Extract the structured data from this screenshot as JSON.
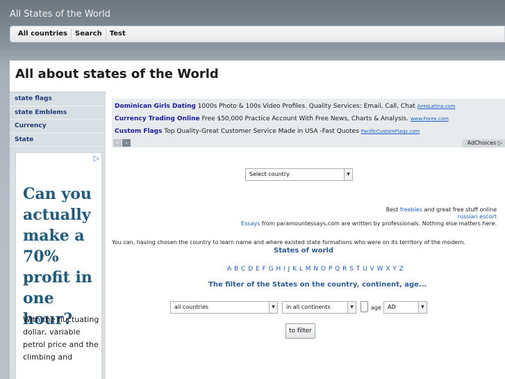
{
  "site": {
    "title": "All States of the World"
  },
  "topnav": {
    "items": [
      "All countries",
      "Search",
      "Test"
    ]
  },
  "page": {
    "title": "All about states of the World"
  },
  "sidebar": {
    "items": [
      "state flags",
      "state Emblems",
      "Currency",
      "State"
    ],
    "ad": {
      "adchoices_icon": "adchoices-triangle",
      "headline": "Can you actually make a 70% profit in one hour?",
      "body": "With the fluctuating dollar, variable petrol price and the climbing and"
    }
  },
  "ads": [
    {
      "title": "Dominican Girls Dating",
      "text": " 1000s Photo & 100s Video Profiles. Quality Services: Email, Call, Chat ",
      "url": "AmoLatina.com"
    },
    {
      "title": "Currency Trading Online",
      "text": " Free $50,000 Practice Account With Free News, Charts & Analysis. ",
      "url": "www.Forex.com"
    },
    {
      "title": "Custom Flags",
      "text": " Top Quality-Great Customer Service Made in USA -Fast Quotes ",
      "url": "PacificCustomFlags.com"
    }
  ],
  "ad_controls": {
    "prev": "‹",
    "next": "›",
    "adchoices": "AdChoices ▷"
  },
  "country_select": {
    "value": "Select country"
  },
  "links_block": {
    "line1_prefix": "Best ",
    "line1_link": "freebies",
    "line1_suffix": " and great free stuff online",
    "line2_link": "russian escort",
    "line3_link": "Essays",
    "line3_suffix": " from paramountessays.com are written by professionals. Nothing else matters here."
  },
  "intro": {
    "text": "You can, having chosen the country to learn name and where existed state formations who were on its territory of the modern.",
    "states_link": "States of world"
  },
  "alphabet": "A B C D E F G H I J K L M N O P Q R S T U V W X Y Z",
  "filter": {
    "heading": "The filter of the States on the country, continent, age...",
    "countries_value": "all countries",
    "continents_value": "in all continents",
    "age_label": "age",
    "era_value": "AD",
    "button_label": "to filter"
  }
}
